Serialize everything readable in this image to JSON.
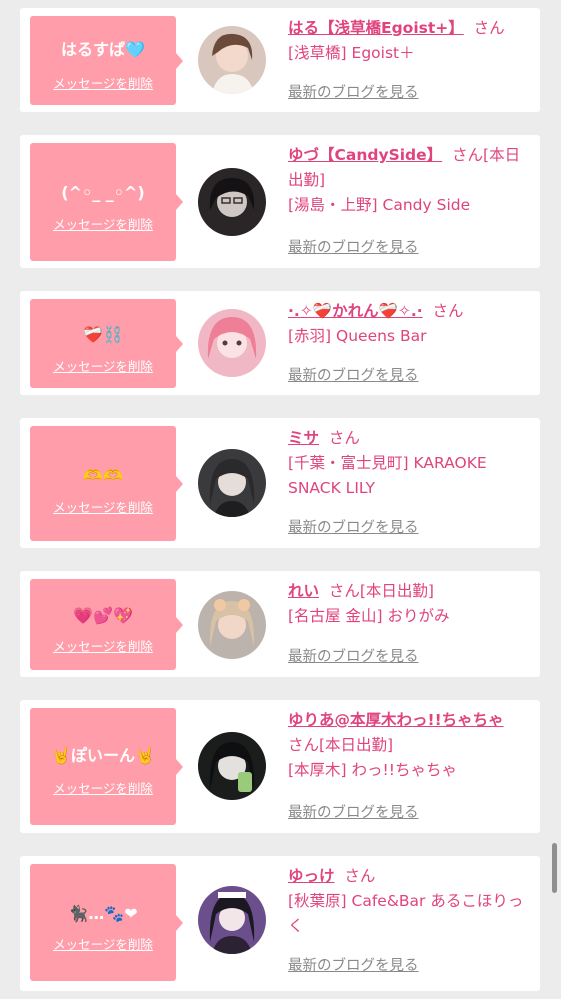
{
  "delete_label": "メッセージを削除",
  "blog_label": "最新のブログを見る",
  "san_label": "さん",
  "entries": [
    {
      "message": "はるすぱ🩵",
      "name": "はる【浅草橋Egoist+】",
      "after_name": "さん",
      "detail": "[浅草橋] Egoist＋"
    },
    {
      "message": "(^◦_ _◦^)",
      "name": "ゆづ【CandySide】",
      "after_name": "さん[本日出勤]",
      "detail": "[湯島・上野] Candy Side"
    },
    {
      "message": "❤️‍🩹⛓️",
      "name": "·.✧❤️‍🩹かれん❤️‍🩹✧.·",
      "after_name": "さん",
      "detail": "[赤羽] Queens Bar"
    },
    {
      "message": "🫶🫶",
      "name": "ミサ",
      "after_name": "さん",
      "detail": "[千葉・富士見町] KARAOKE SNACK LILY"
    },
    {
      "message": "💗💕💖",
      "name": "れい",
      "after_name": "さん[本日出勤]",
      "detail": "[名古屋 金山] おりがみ"
    },
    {
      "message": "🤘ぽいーん🤘",
      "name": "ゆりあ@本厚木わっ!!ちゃちゃ",
      "after_name": "さん[本日出勤]",
      "detail": "[本厚木] わっ!!ちゃちゃ"
    },
    {
      "message": "🐈‍⬛…🐾❤",
      "name": "ゆっけ",
      "after_name": "さん",
      "detail": "[秋葉原] Cafe&Bar あるこほりっく"
    }
  ]
}
